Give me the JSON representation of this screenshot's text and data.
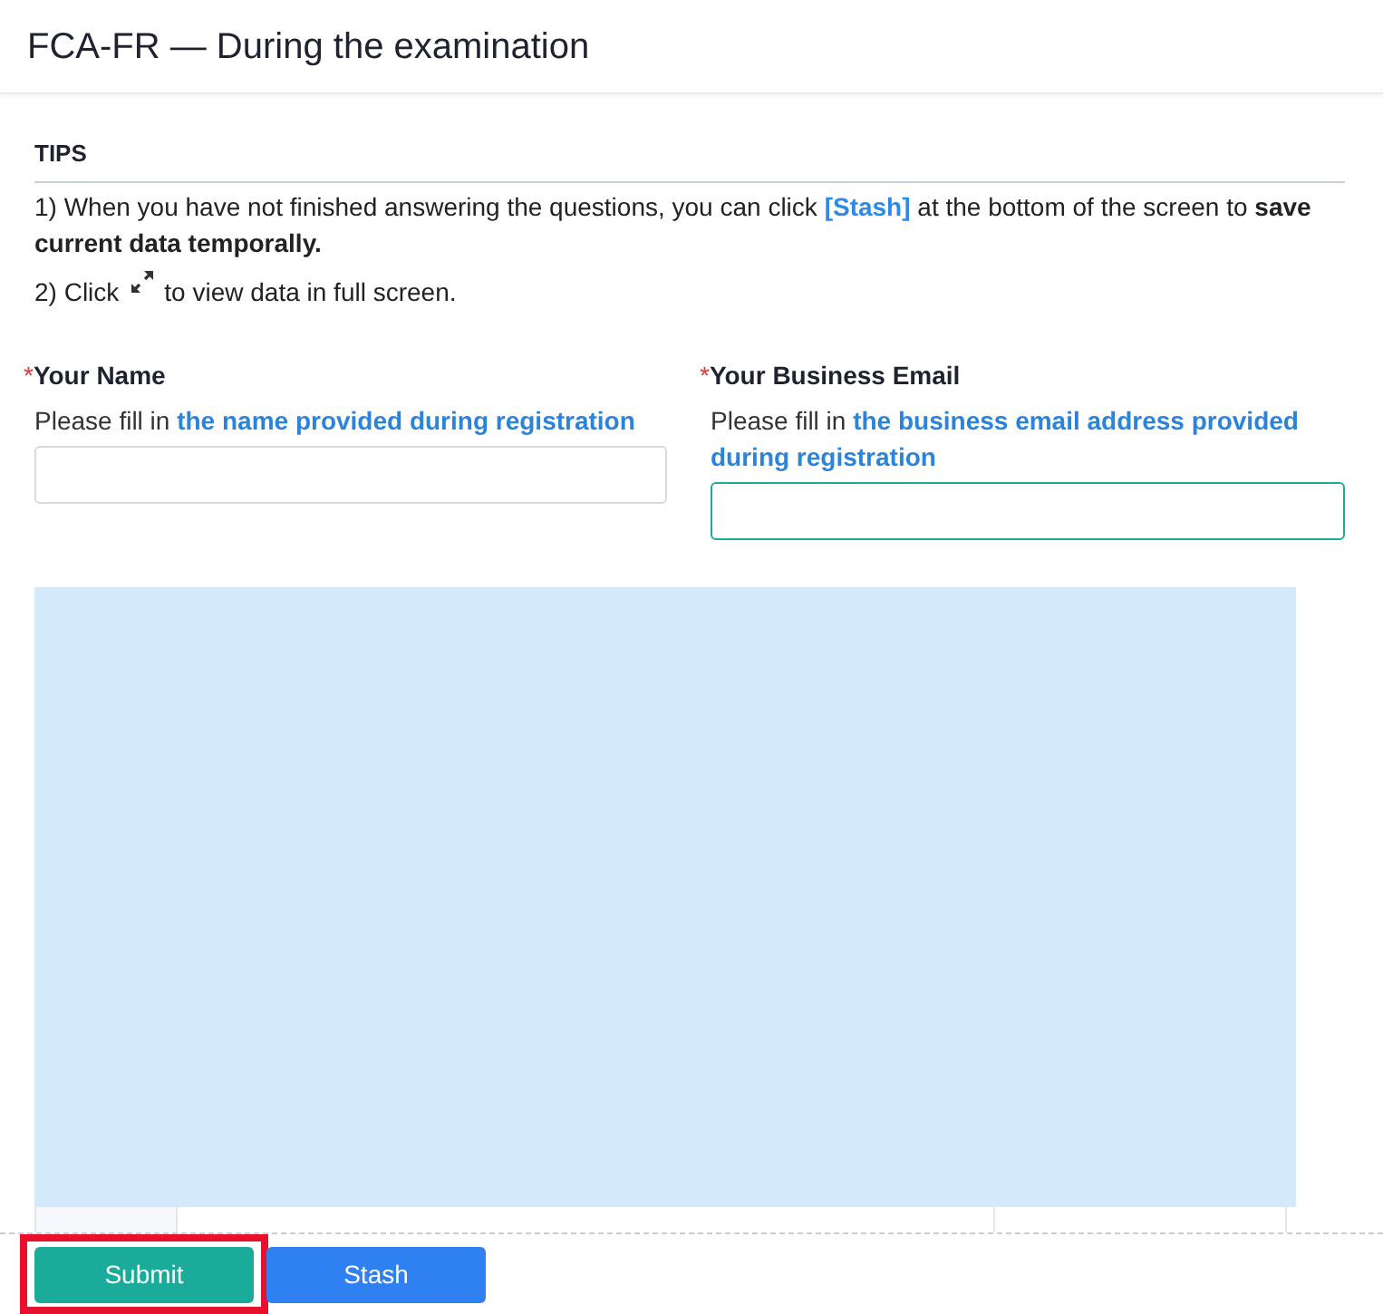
{
  "header": {
    "title": "FCA-FR — During the examination"
  },
  "tips": {
    "heading": "TIPS",
    "items": [
      {
        "kind": "link",
        "before": "1) When you have not finished answering the questions, you can click",
        "link": "[Stash]",
        "after": "at the bottom of the screen to **save current data temporally.**"
      },
      {
        "kind": "icon",
        "before": "2) Click",
        "after": "to view data in full screen."
      }
    ]
  },
  "fields": [
    {
      "required_mark": "*",
      "label": "Your Name",
      "hint": "Please fill in **the name provided during registration**",
      "focused": false
    },
    {
      "required_mark": "*",
      "label": "Your Business Email",
      "hint": "Please fill in **the business email address provided during registration**",
      "focused": true
    }
  ],
  "buttons": [
    {
      "label": "Submit",
      "kind": "primary",
      "highlighted": true
    },
    {
      "label": "Stash",
      "kind": "secondary",
      "highlighted": false
    }
  ]
}
